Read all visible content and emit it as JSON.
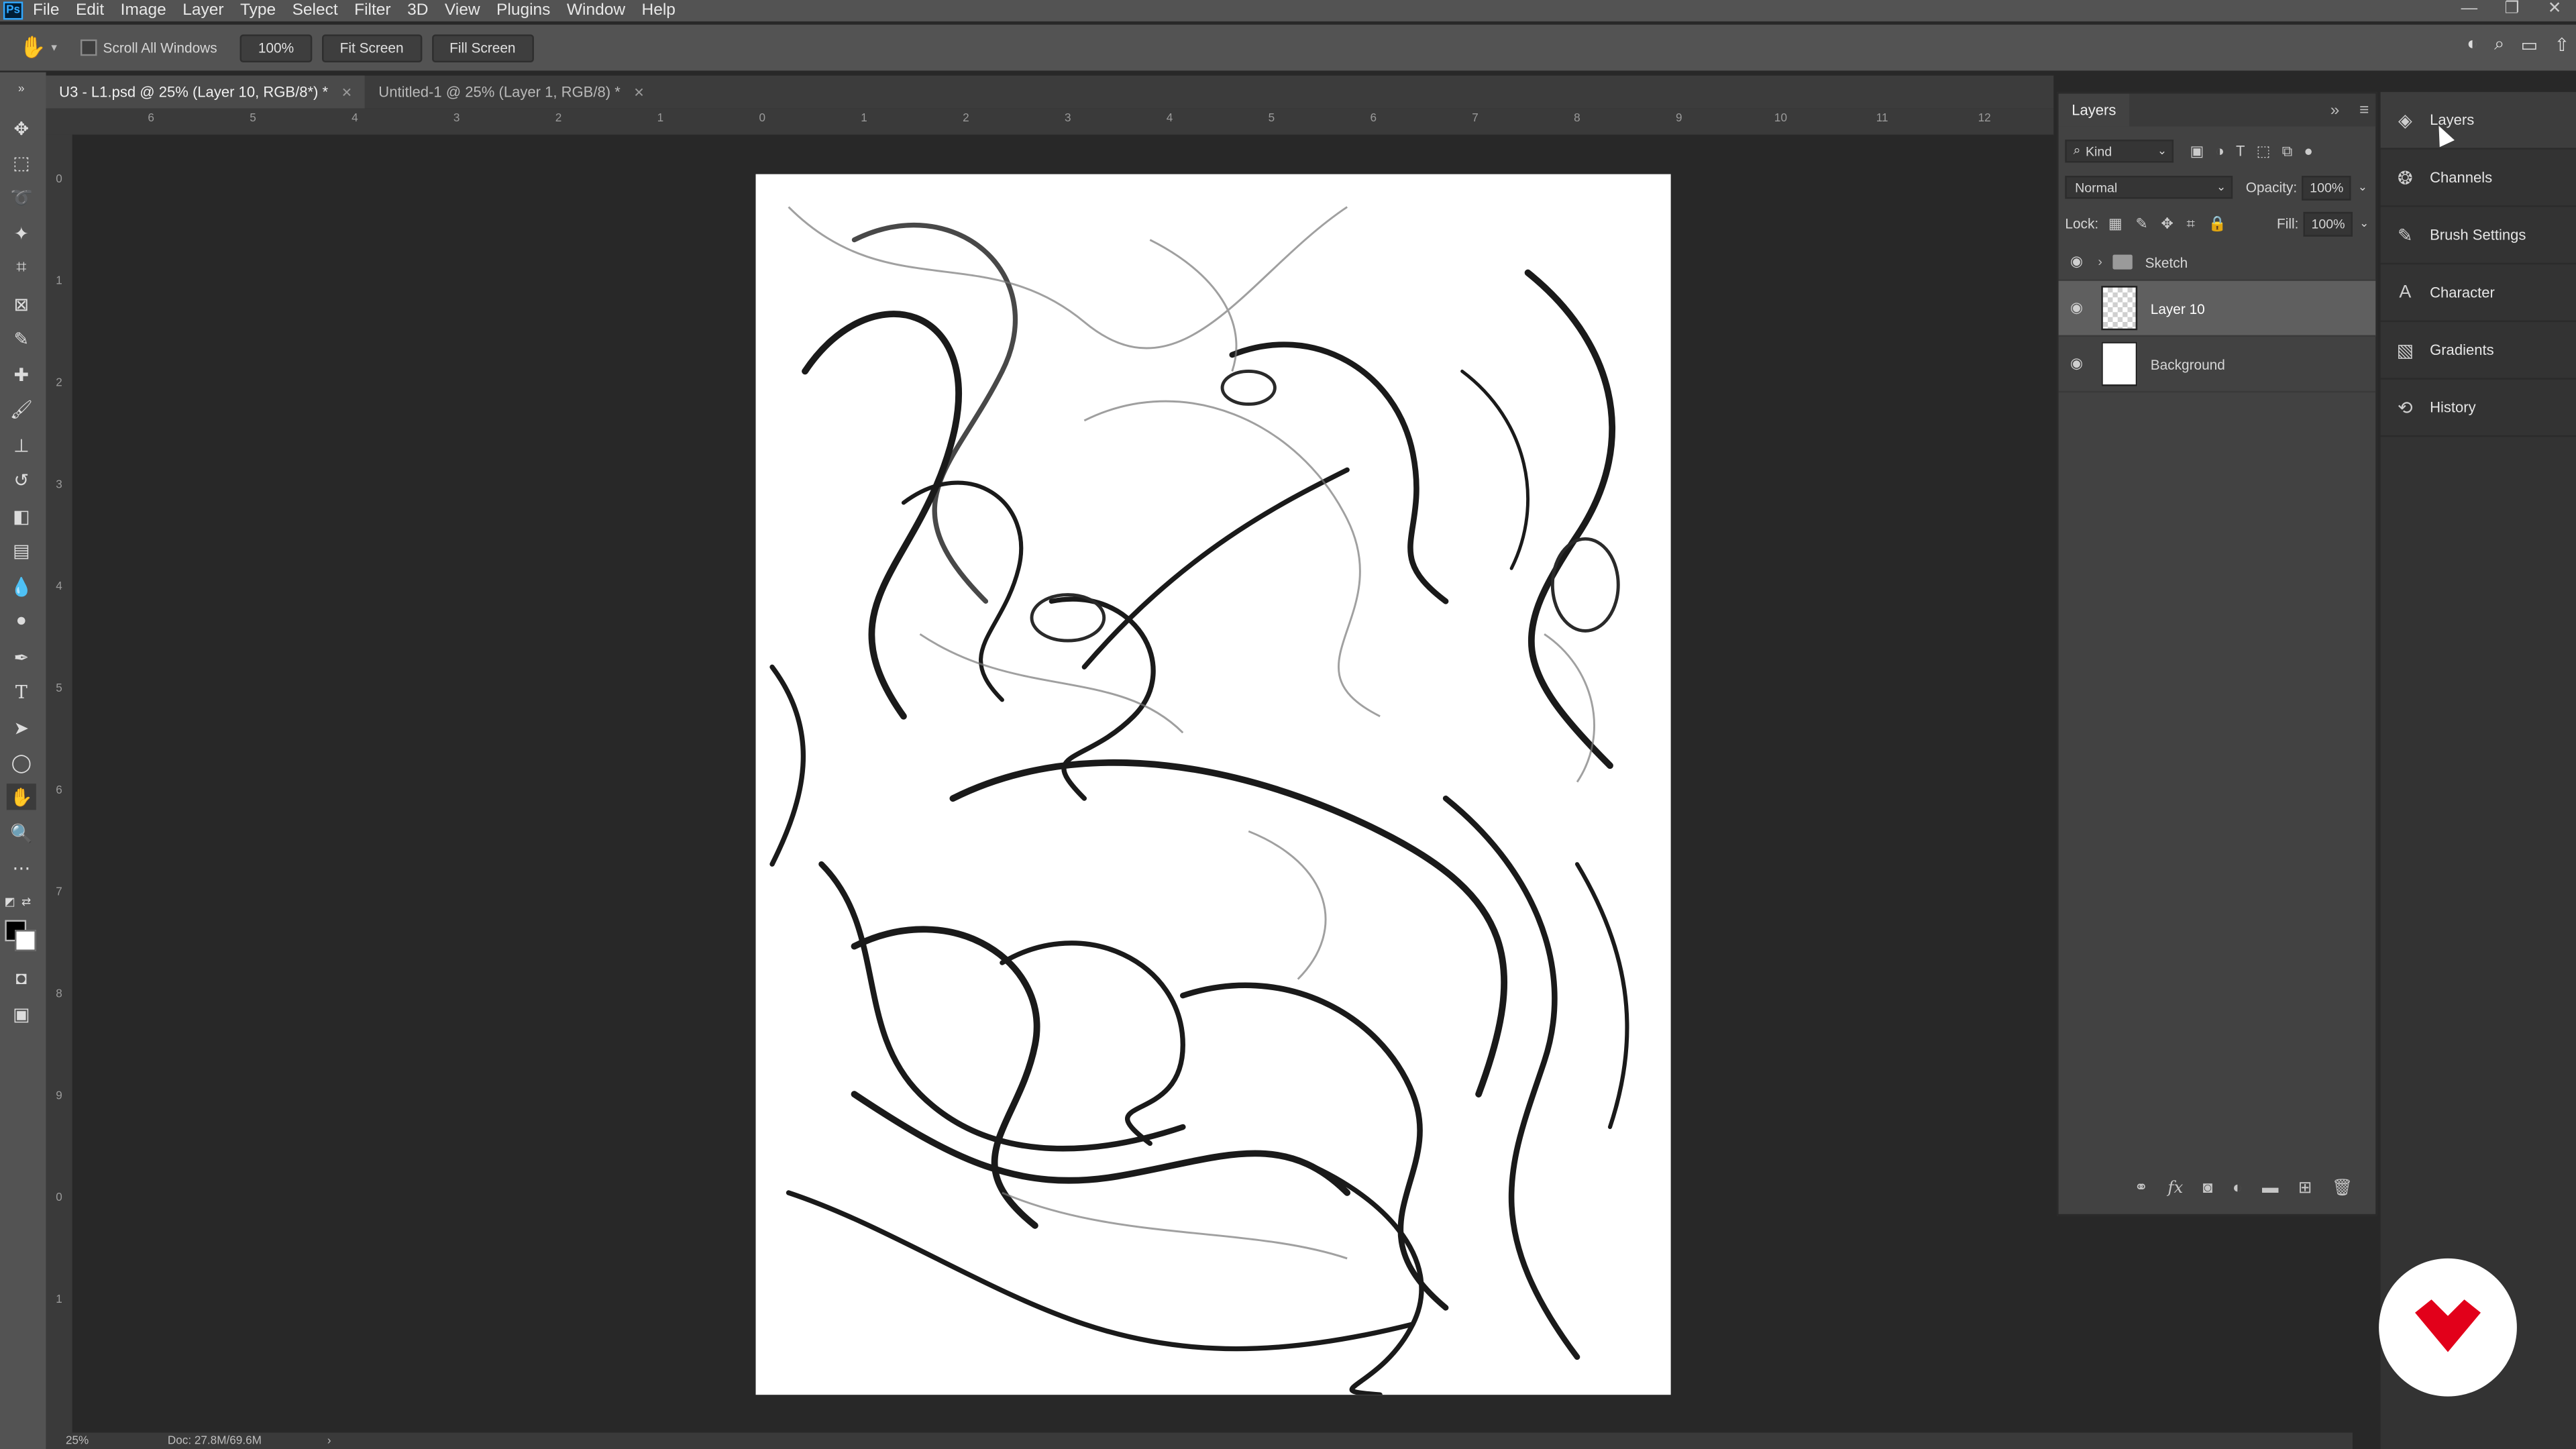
{
  "app": {
    "logo_text": "Ps"
  },
  "menubar": {
    "items": [
      "File",
      "Edit",
      "Image",
      "Layer",
      "Type",
      "Select",
      "Filter",
      "3D",
      "View",
      "Plugins",
      "Window",
      "Help"
    ]
  },
  "window_controls": {
    "minimize": "—",
    "restore": "❐",
    "close": "✕"
  },
  "options_bar": {
    "scroll_all_windows": "Scroll All Windows",
    "zoom_button": "100%",
    "fit_screen": "Fit Screen",
    "fill_screen": "Fill Screen"
  },
  "tabs": [
    {
      "label": "U3 - L1.psd @ 25% (Layer 10, RGB/8*) *",
      "active": true
    },
    {
      "label": "Untitled-1 @ 25% (Layer 1, RGB/8) *",
      "active": false
    }
  ],
  "ruler": {
    "h_ticks": [
      "6",
      "5",
      "4",
      "3",
      "2",
      "1",
      "0",
      "1",
      "2",
      "3",
      "4",
      "5",
      "6",
      "7",
      "8",
      "9",
      "10",
      "11",
      "12"
    ],
    "v_ticks": [
      "0",
      "1",
      "2",
      "3",
      "4",
      "5",
      "6",
      "7",
      "8",
      "9",
      "0",
      "1"
    ]
  },
  "status": {
    "zoom": "25%",
    "doc": "Doc: 27.8M/69.6M",
    "arrow": "›"
  },
  "layers_panel": {
    "title": "Layers",
    "kind_filter": "Kind",
    "blend_mode": "Normal",
    "opacity_label": "Opacity:",
    "opacity_value": "100%",
    "lock_label": "Lock:",
    "fill_label": "Fill:",
    "fill_value": "100%",
    "layers": [
      {
        "name": "Sketch",
        "type": "group"
      },
      {
        "name": "Layer 10",
        "type": "layer",
        "selected": true
      },
      {
        "name": "Background",
        "type": "layer"
      }
    ]
  },
  "side_dock": {
    "items": [
      "Layers",
      "Channels",
      "Brush Settings",
      "Character",
      "Gradients",
      "History"
    ]
  },
  "colors": {
    "accent": "#31a8ff",
    "badge_red": "#e2001a"
  }
}
